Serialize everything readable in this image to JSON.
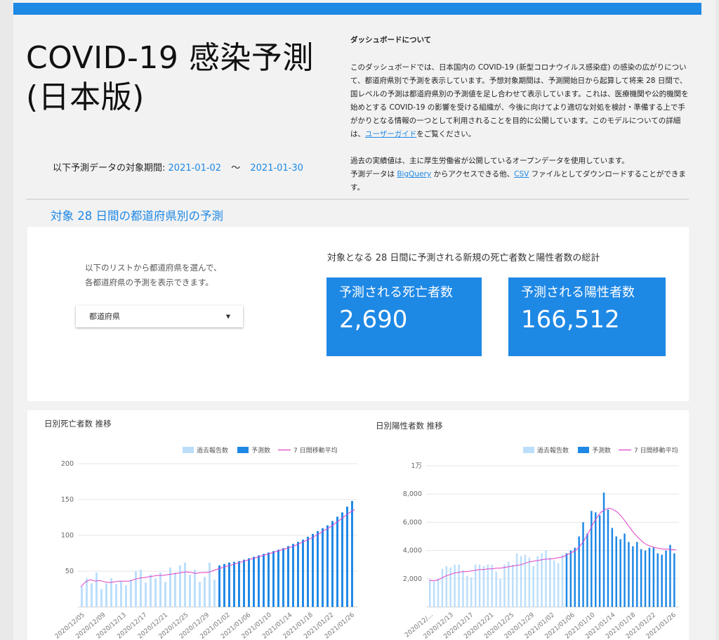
{
  "header": {
    "title": "COVID-19 感染予測 (日本版)",
    "period_label": "以下予測データの対象期間:",
    "period_start": "2021-01-02",
    "period_sep": "〜",
    "period_end": "2021-01-30"
  },
  "about": {
    "heading": "ダッシュボードについて",
    "p1_text": "このダッシュボードでは、日本国内の COVID-19 (新型コロナウイルス感染症) の感染の広がりについて、都道府県別で予測を表示しています。予想対象期間は、予測開始日から起算して将来 28 日間で、国レベルの予測は都道府県別の予測値を足し合わせて表示しています。これは、医療機関や公的機関を始めとする COVID-19 の影響を受ける組織が、今後に向けてより適切な対処を検討・準備する上で手がかりとなる情報の一つとして利用されることを目的に公開しています。このモデルについての詳細は、",
    "p1_link": "ユーザーガイド",
    "p1_end": "をご覧ください。",
    "p2_line1": "過去の実績値は、主に厚生労働省が公開しているオープンデータを使用しています。",
    "p2_a": "予測データは ",
    "p2_link1": "BigQuery",
    "p2_b": " からアクセスできる他、",
    "p2_link2": "CSV",
    "p2_c": " ファイルとしてダウンロードすることができます。"
  },
  "section": {
    "title": "対象 28 日間の都道府県別の予測"
  },
  "selector": {
    "instruction_line1": "以下のリストから都道府県を選んで、",
    "instruction_line2": "各都道府県の予測を表示できます。",
    "dropdown_value": "都道府県"
  },
  "kpis": {
    "heading": "対象となる 28 日間に予測される新規の死亡者数と陽性者数の総計",
    "deaths_label": "予測される死亡者数",
    "deaths_value": "2,690",
    "positives_label": "予測される陽性者数",
    "positives_value": "166,512"
  },
  "colors": {
    "accent": "#1e88e5",
    "past": "#bbdefb",
    "forecast": "#1e88e5",
    "average": "#e040c8"
  },
  "chart_data": [
    {
      "type": "bar",
      "title": "日別死亡者数 推移",
      "legend": [
        "過去報告数",
        "予測数",
        "7 日間移動平均"
      ],
      "legend_position": "top-right",
      "ylim": [
        0,
        200
      ],
      "yticks": [
        50,
        100,
        150,
        200
      ],
      "ytick_labels": [
        "50",
        "100",
        "150",
        "200"
      ],
      "xtick_labels": [
        "2020/12/05",
        "2020/12/09",
        "2020/12/13",
        "2020/12/17",
        "2020/12/21",
        "2020/12/25",
        "2020/12/29",
        "2021/01/02",
        "2021/01/06",
        "2021/01/10",
        "2021/01/14",
        "2021/01/18",
        "2021/01/22",
        "2021/01/26"
      ],
      "start_date": "2020/12/05",
      "past_values": [
        28,
        40,
        33,
        48,
        25,
        33,
        40,
        32,
        36,
        30,
        38,
        50,
        52,
        34,
        45,
        40,
        48,
        35,
        55,
        48,
        58,
        62,
        45,
        52,
        35,
        42,
        62,
        38
      ],
      "forecast_values": [
        58,
        60,
        62,
        63,
        64,
        66,
        68,
        70,
        72,
        74,
        76,
        78,
        80,
        82,
        85,
        88,
        91,
        94,
        98,
        102,
        106,
        110,
        114,
        120,
        126,
        132,
        140,
        148
      ],
      "average_values": [
        28,
        35,
        38,
        36,
        37,
        35,
        34,
        35,
        36,
        36,
        36,
        38,
        40,
        41,
        42,
        43,
        44,
        44,
        45,
        46,
        47,
        48,
        49,
        48,
        47,
        48,
        48,
        49,
        52,
        54,
        56,
        58,
        60,
        62,
        64,
        66,
        68,
        70,
        72,
        74,
        76,
        78,
        80,
        82,
        84,
        87,
        90,
        93,
        96,
        100,
        104,
        108,
        112,
        117,
        122,
        127,
        132,
        136
      ]
    },
    {
      "type": "bar",
      "title": "日別陽性者数 推移",
      "legend": [
        "過去報告数",
        "予測数",
        "7 日間移動平均"
      ],
      "legend_position": "top-right",
      "ylim": [
        0,
        10000
      ],
      "yticks": [
        2000,
        4000,
        6000,
        8000,
        10000
      ],
      "ytick_labels": [
        "2,000",
        "4,000",
        "6,000",
        "8,000",
        "1万"
      ],
      "xtick_labels": [
        "2020/12/...",
        "2020/12/13",
        "2020/12/17",
        "2020/12/21",
        "2020/12/25",
        "2020/12/29",
        "2021/01/02",
        "2021/01/06",
        "2021/01/10",
        "2021/01/14",
        "2021/01/18",
        "2021/01/22",
        "2021/01/26"
      ],
      "start_date": "2020/12/09",
      "past_values": [
        1900,
        1800,
        2000,
        2700,
        2900,
        2800,
        3000,
        3000,
        2600,
        2200,
        2100,
        3000,
        3000,
        2900,
        3000,
        3000,
        2500,
        2000,
        3000,
        3200,
        3000,
        3800,
        3600,
        3700,
        3500,
        2900,
        3600,
        3800,
        4000,
        3500,
        3300,
        3100,
        3700
      ],
      "forecast_values": [
        3800,
        4000,
        4200,
        5000,
        6000,
        5200,
        6800,
        6700,
        6500,
        8100,
        6900,
        5600,
        5000,
        4800,
        5200,
        4600,
        4300,
        4600,
        4100,
        4000,
        4200,
        4200,
        3800,
        3700,
        4000,
        4400,
        3800
      ],
      "average_values": [
        1900,
        1850,
        1900,
        2050,
        2200,
        2300,
        2400,
        2450,
        2500,
        2500,
        2550,
        2600,
        2650,
        2650,
        2700,
        2700,
        2750,
        2750,
        2800,
        2850,
        2900,
        2950,
        3000,
        3100,
        3200,
        3250,
        3300,
        3350,
        3400,
        3400,
        3450,
        3500,
        3550,
        3700,
        3850,
        4000,
        4300,
        4700,
        5200,
        5800,
        6300,
        6700,
        6900,
        7000,
        6900,
        6700,
        6400,
        6000,
        5600,
        5200,
        4900,
        4600,
        4400,
        4300,
        4200,
        4150,
        4100,
        4100,
        4050,
        4050
      ]
    }
  ]
}
